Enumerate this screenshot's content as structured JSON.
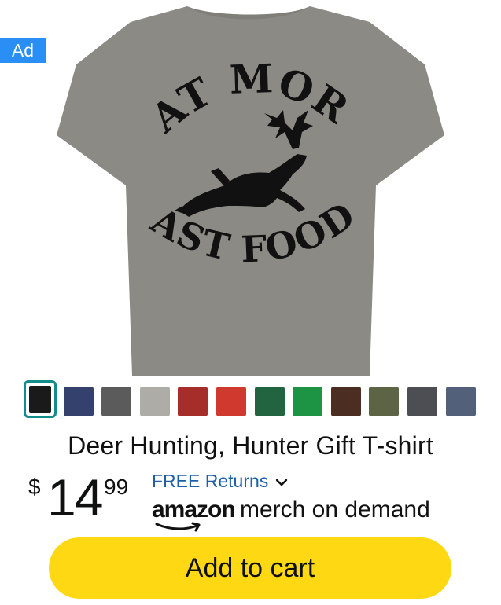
{
  "ad": {
    "label": "Ad"
  },
  "product": {
    "image_text_top": "EAT MORE",
    "image_text_bottom": "FAST FOOD.",
    "title": "Deer Hunting, Hunter Gift T-shirt",
    "price": {
      "currency_symbol": "$",
      "whole": "14",
      "fraction": "99"
    },
    "returns_label": "FREE Returns",
    "seller": {
      "brand": "amazon",
      "tagline": "merch on demand"
    }
  },
  "swatches": [
    {
      "name": "black",
      "color": "#1a1a1a",
      "selected": true
    },
    {
      "name": "navy",
      "color": "#34416c",
      "selected": false
    },
    {
      "name": "dark-heather",
      "color": "#5b5b5b",
      "selected": false
    },
    {
      "name": "heather-grey",
      "color": "#adaca6",
      "selected": false
    },
    {
      "name": "cranberry",
      "color": "#a52d2a",
      "selected": false
    },
    {
      "name": "red",
      "color": "#d03a2e",
      "selected": false
    },
    {
      "name": "kelly-green-dark",
      "color": "#21643f",
      "selected": false
    },
    {
      "name": "kelly-green",
      "color": "#1d9444",
      "selected": false
    },
    {
      "name": "brown",
      "color": "#4b2d22",
      "selected": false
    },
    {
      "name": "olive",
      "color": "#5d6345",
      "selected": false
    },
    {
      "name": "asphalt",
      "color": "#4d4e53",
      "selected": false
    },
    {
      "name": "slate",
      "color": "#53607a",
      "selected": false
    }
  ],
  "cart": {
    "button_label": "Add to cart"
  },
  "colors": {
    "shirt": "#8b8a84",
    "accent": "#ffd814",
    "link": "#1f5fa8",
    "ad_badge": "#2a8ff5"
  }
}
